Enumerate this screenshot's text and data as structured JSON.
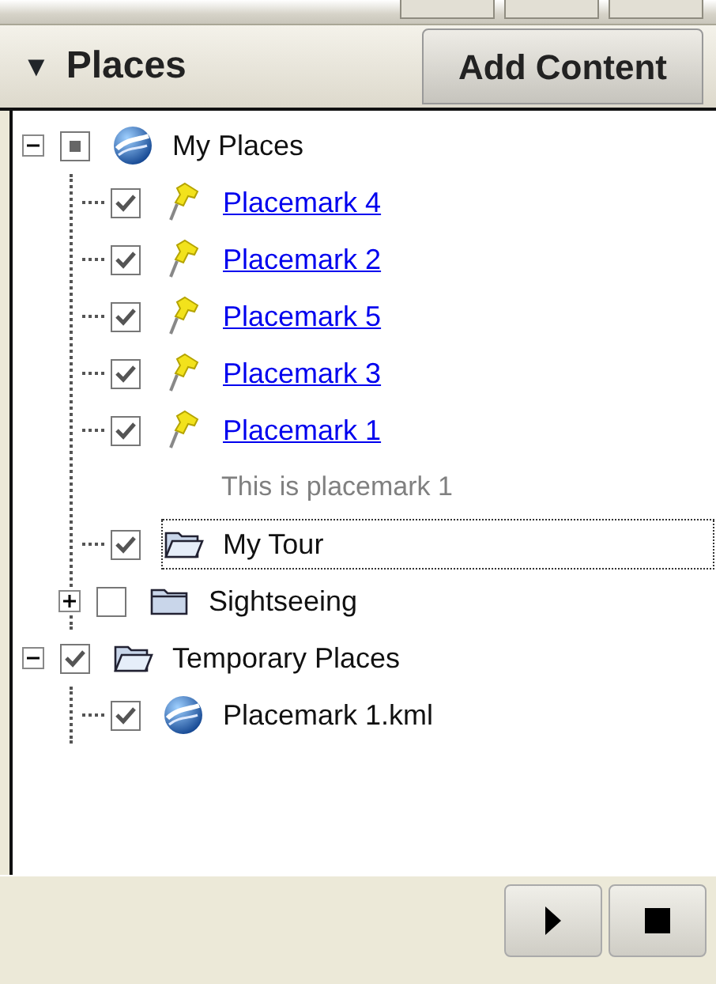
{
  "header": {
    "toggle": "▼",
    "title": "Places",
    "button": "Add Content"
  },
  "tree": [
    {
      "kind": "globe",
      "label": "My Places",
      "checked": true,
      "partial": true,
      "expanded": true,
      "link": false,
      "focused": false,
      "children": [
        {
          "kind": "placemark",
          "label": "Placemark 4",
          "checked": true,
          "link": true,
          "focused": false
        },
        {
          "kind": "placemark",
          "label": "Placemark 2",
          "checked": true,
          "link": true,
          "focused": false
        },
        {
          "kind": "placemark",
          "label": "Placemark 5",
          "checked": true,
          "link": true,
          "focused": false
        },
        {
          "kind": "placemark",
          "label": "Placemark 3",
          "checked": true,
          "link": true,
          "focused": false
        },
        {
          "kind": "placemark",
          "label": "Placemark 1",
          "checked": true,
          "link": true,
          "focused": false,
          "description": "This is placemark 1"
        },
        {
          "kind": "folder-open",
          "label": "My Tour",
          "checked": true,
          "link": false,
          "focused": true
        },
        {
          "kind": "folder",
          "label": "Sightseeing",
          "checked": false,
          "expanded": false,
          "link": false,
          "focused": false
        }
      ]
    },
    {
      "kind": "folder-open",
      "label": "Temporary Places",
      "checked": true,
      "expanded": true,
      "link": false,
      "focused": false,
      "children": [
        {
          "kind": "globe",
          "label": "Placemark 1.kml",
          "checked": true,
          "link": false,
          "focused": false
        }
      ]
    }
  ]
}
